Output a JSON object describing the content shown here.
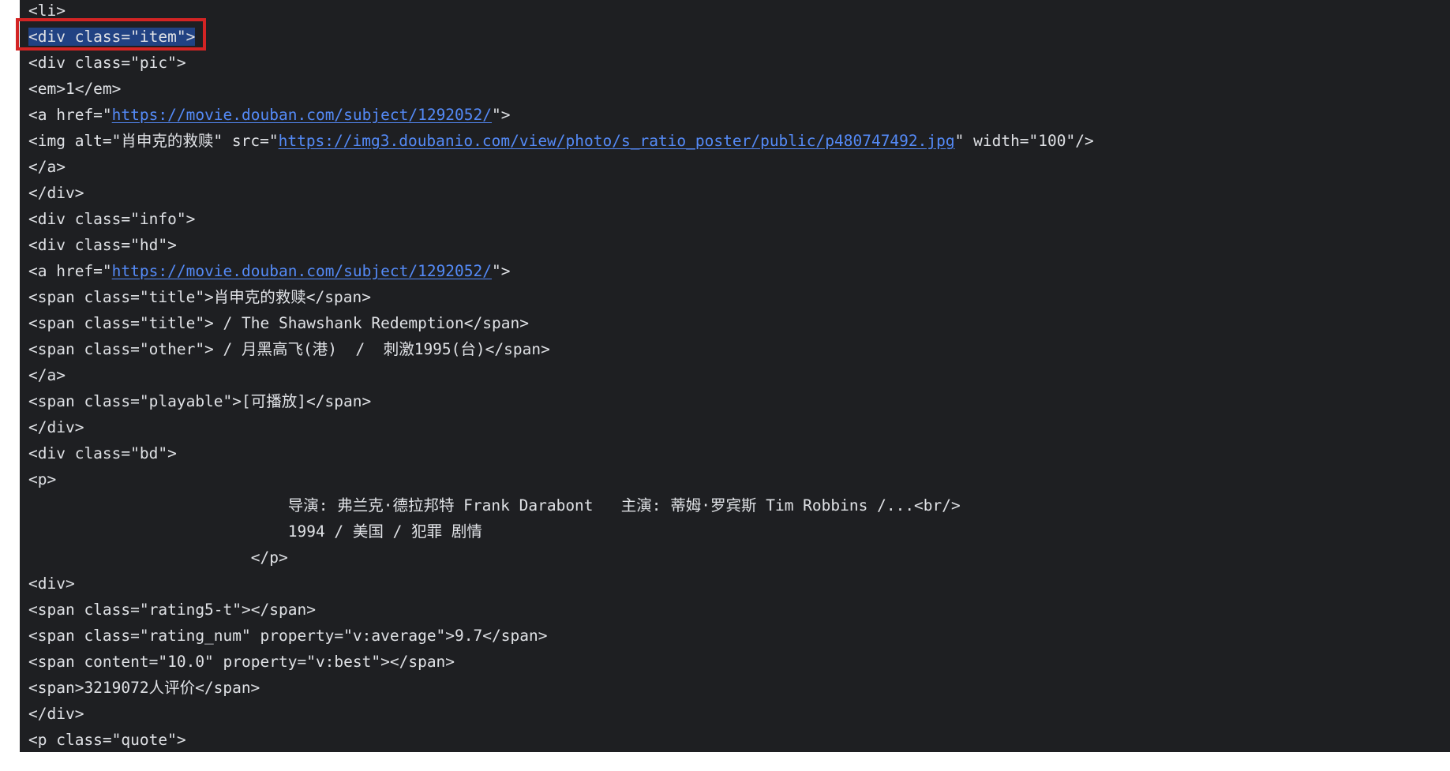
{
  "editor": {
    "highlight": {
      "color": "#d32424",
      "line": 2
    },
    "colors": {
      "background": "#1e1f22",
      "text": "#dfe1e5",
      "link": "#548af7",
      "selection": "#214283"
    },
    "lines": [
      {
        "segments": [
          {
            "text": "<li>"
          }
        ]
      },
      {
        "segments": [
          {
            "text": "<div class=\"item\">",
            "selected": true,
            "caret": true
          }
        ]
      },
      {
        "segments": [
          {
            "text": "<div class=\"pic\">"
          }
        ]
      },
      {
        "segments": [
          {
            "text": "<em>1</em>"
          }
        ]
      },
      {
        "segments": [
          {
            "text": "<a href=\""
          },
          {
            "text": "https://movie.douban.com/subject/1292052/",
            "link": true
          },
          {
            "text": "\">"
          }
        ]
      },
      {
        "segments": [
          {
            "text": "<img alt=\"肖申克的救赎\" src=\""
          },
          {
            "text": "https://img3.doubanio.com/view/photo/s_ratio_poster/public/p480747492.jpg",
            "link": true
          },
          {
            "text": "\" width=\"100\"/>"
          }
        ]
      },
      {
        "segments": [
          {
            "text": "</a>"
          }
        ]
      },
      {
        "segments": [
          {
            "text": "</div>"
          }
        ]
      },
      {
        "segments": [
          {
            "text": "<div class=\"info\">"
          }
        ]
      },
      {
        "segments": [
          {
            "text": "<div class=\"hd\">"
          }
        ]
      },
      {
        "segments": [
          {
            "text": "<a href=\""
          },
          {
            "text": "https://movie.douban.com/subject/1292052/",
            "link": true
          },
          {
            "text": "\">"
          }
        ]
      },
      {
        "segments": [
          {
            "text": "<span class=\"title\">肖申克的救赎</span>"
          }
        ]
      },
      {
        "segments": [
          {
            "text": "<span class=\"title\"> / The Shawshank Redemption</span>"
          }
        ]
      },
      {
        "segments": [
          {
            "text": "<span class=\"other\"> / 月黑高飞(港)  /  刺激1995(台)</span>"
          }
        ]
      },
      {
        "segments": [
          {
            "text": "</a>"
          }
        ]
      },
      {
        "segments": [
          {
            "text": "<span class=\"playable\">[可播放]</span>"
          }
        ]
      },
      {
        "segments": [
          {
            "text": "</div>"
          }
        ]
      },
      {
        "segments": [
          {
            "text": "<div class=\"bd\">"
          }
        ]
      },
      {
        "segments": [
          {
            "text": "<p>"
          }
        ]
      },
      {
        "segments": [
          {
            "text": "                            导演: 弗兰克·德拉邦特 Frank Darabont   主演: 蒂姆·罗宾斯 Tim Robbins /...<br/>"
          }
        ]
      },
      {
        "segments": [
          {
            "text": "                            1994 / 美国 / 犯罪 剧情"
          }
        ]
      },
      {
        "segments": [
          {
            "text": "                        </p>"
          }
        ]
      },
      {
        "segments": [
          {
            "text": "<div>"
          }
        ]
      },
      {
        "segments": [
          {
            "text": "<span class=\"rating5-t\"></span>"
          }
        ]
      },
      {
        "segments": [
          {
            "text": "<span class=\"rating_num\" property=\"v:average\">9.7</span>"
          }
        ]
      },
      {
        "segments": [
          {
            "text": "<span content=\"10.0\" property=\"v:best\"></span>"
          }
        ]
      },
      {
        "segments": [
          {
            "text": "<span>3219072人评价</span>"
          }
        ]
      },
      {
        "segments": [
          {
            "text": "</div>"
          }
        ]
      },
      {
        "segments": [
          {
            "text": "<p class=\"quote\">"
          }
        ]
      }
    ]
  }
}
